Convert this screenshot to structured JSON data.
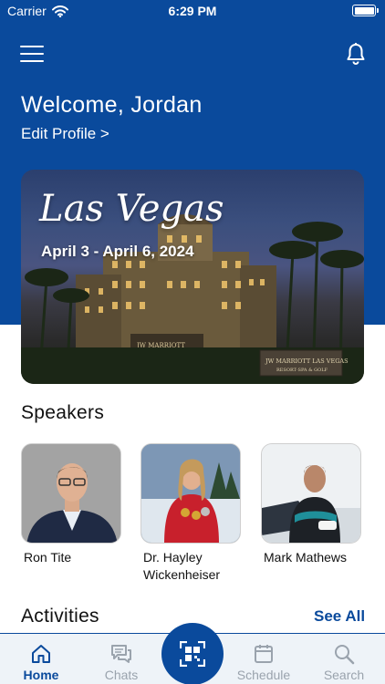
{
  "status_bar": {
    "carrier": "Carrier",
    "time": "6:29 PM"
  },
  "header": {
    "welcome": "Welcome, Jordan",
    "edit_profile": "Edit Profile >"
  },
  "event": {
    "title": "Las Vegas",
    "dates": "April 3 - April 6, 2024",
    "sign_text": "JW MARRIOTT  LAS VEGAS",
    "sign_sub": "RESORT·SPA & GOLF",
    "facade_text": "JW MARRIOTT"
  },
  "speakers": {
    "title": "Speakers",
    "items": [
      {
        "name": "Ron Tite"
      },
      {
        "name": "Dr. Hayley Wickenheiser"
      },
      {
        "name": "Mark Mathews"
      }
    ]
  },
  "activities": {
    "title": "Activities",
    "see_all": "See All"
  },
  "tabbar": {
    "home": "Home",
    "chats": "Chats",
    "schedule": "Schedule",
    "search": "Search"
  },
  "colors": {
    "brand": "#0a4a9c",
    "tab_inactive": "#9aa3ad",
    "tabbar_bg": "#eef3f8"
  }
}
